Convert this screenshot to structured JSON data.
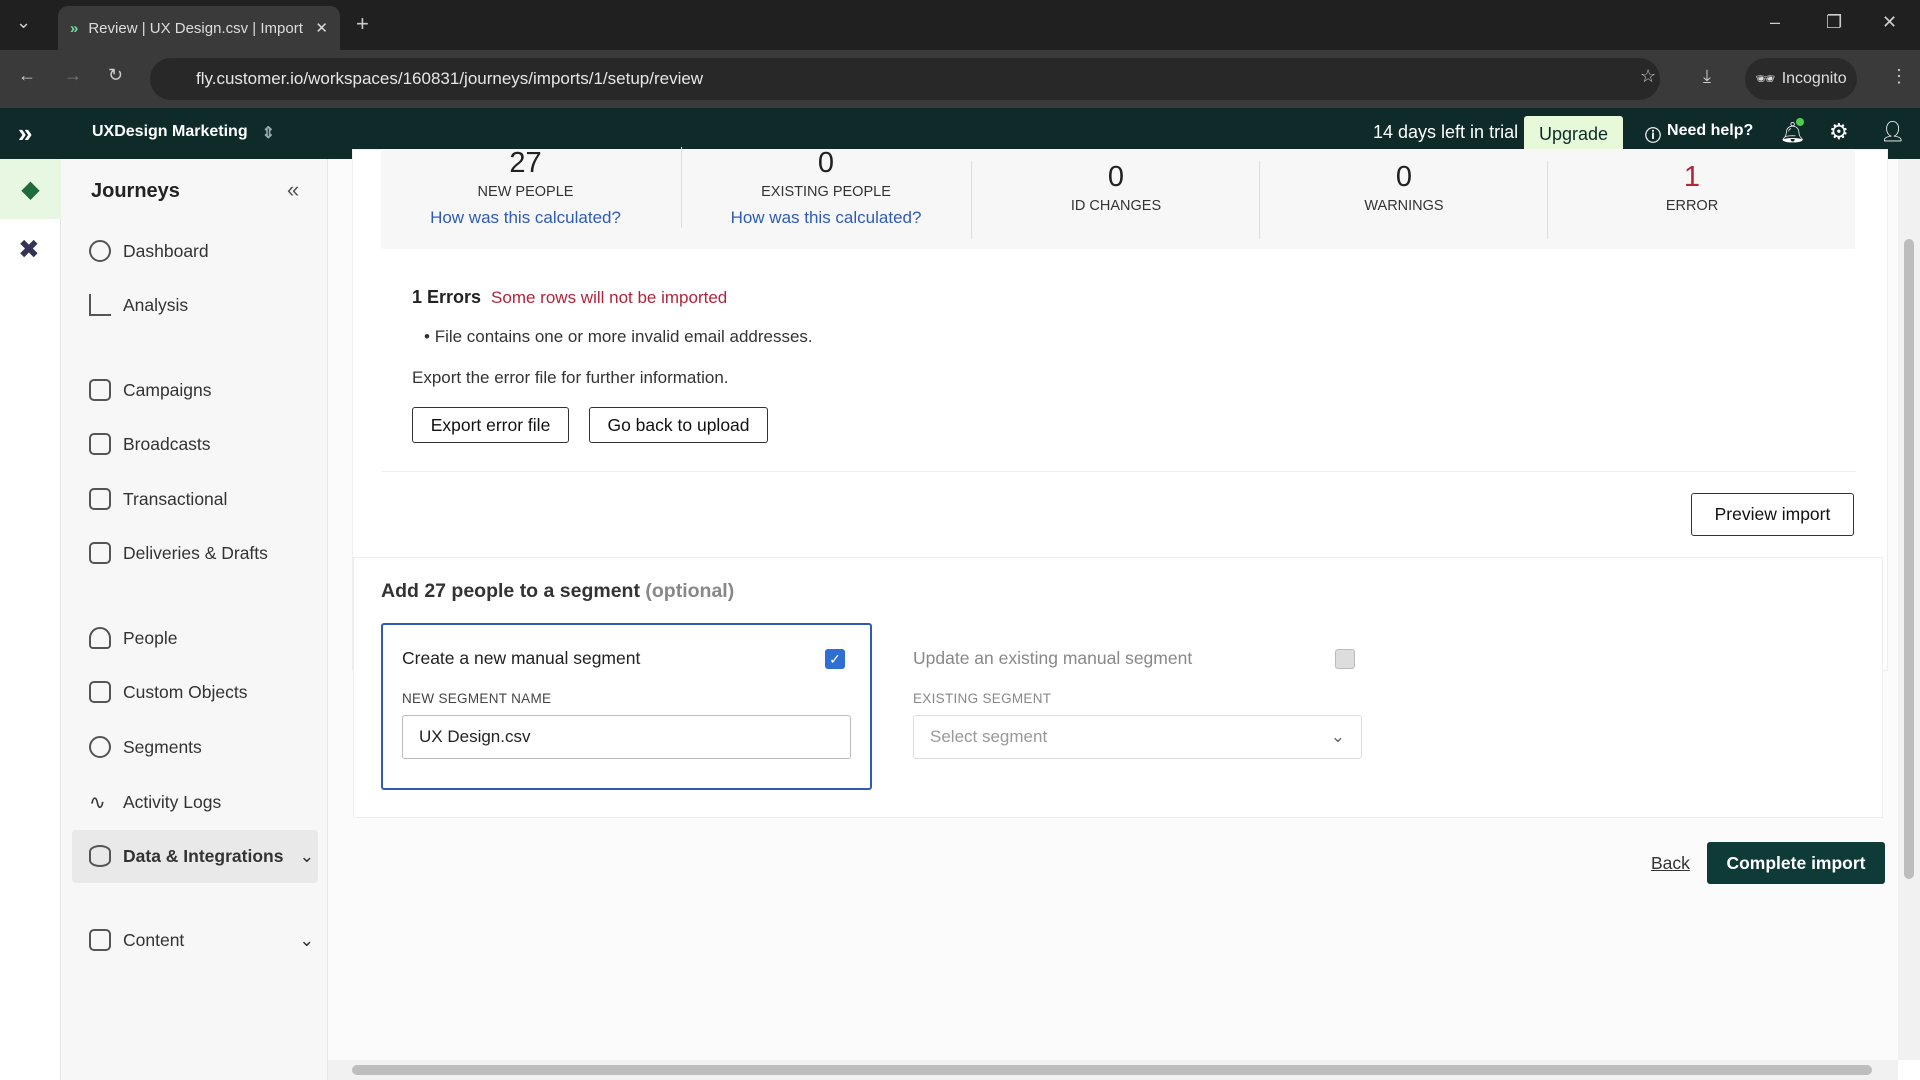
{
  "browser": {
    "tab_title": "Review | UX Design.csv | Import",
    "url": "fly.customer.io/workspaces/160831/journeys/imports/1/setup/review",
    "incognito": "Incognito"
  },
  "header": {
    "workspace": "UXDesign Marketing",
    "trial": "14 days left in trial",
    "upgrade": "Upgrade",
    "help": "Need help?"
  },
  "sidebar": {
    "title": "Journeys",
    "items": [
      {
        "label": "Dashboard"
      },
      {
        "label": "Analysis"
      },
      {
        "label": "Campaigns"
      },
      {
        "label": "Broadcasts"
      },
      {
        "label": "Transactional"
      },
      {
        "label": "Deliveries & Drafts"
      },
      {
        "label": "People"
      },
      {
        "label": "Custom Objects"
      },
      {
        "label": "Segments"
      },
      {
        "label": "Activity Logs"
      },
      {
        "label": "Data & Integrations"
      },
      {
        "label": "Content"
      }
    ]
  },
  "stats": [
    {
      "value": "27",
      "label": "NEW PEOPLE",
      "link": "How was this calculated?"
    },
    {
      "value": "0",
      "label": "EXISTING PEOPLE",
      "link": "How was this calculated?"
    },
    {
      "value": "0",
      "label": "ID CHANGES"
    },
    {
      "value": "0",
      "label": "WARNINGS"
    },
    {
      "value": "1",
      "label": "ERROR"
    }
  ],
  "errors": {
    "title": "1 Errors",
    "subtitle": "Some rows will not be imported",
    "bullet": "File contains one or more invalid email addresses.",
    "note": "Export the error file for further information.",
    "export": "Export error file",
    "back_upload": "Go back to upload"
  },
  "preview": "Preview import",
  "segment": {
    "title": "Add 27 people to a segment",
    "optional": "(optional)",
    "new_title": "Create a new manual segment",
    "new_checked": true,
    "new_label": "NEW SEGMENT NAME",
    "new_value": "UX Design.csv",
    "existing_title": "Update an existing manual segment",
    "existing_checked": false,
    "existing_label": "EXISTING SEGMENT",
    "existing_placeholder": "Select segment"
  },
  "footer": {
    "back": "Back",
    "complete": "Complete import"
  },
  "colors": {
    "brand": "#0e2b2a",
    "error": "#b3243b",
    "link": "#2f5bb7",
    "upgrade_bg": "#e6f9d8"
  }
}
